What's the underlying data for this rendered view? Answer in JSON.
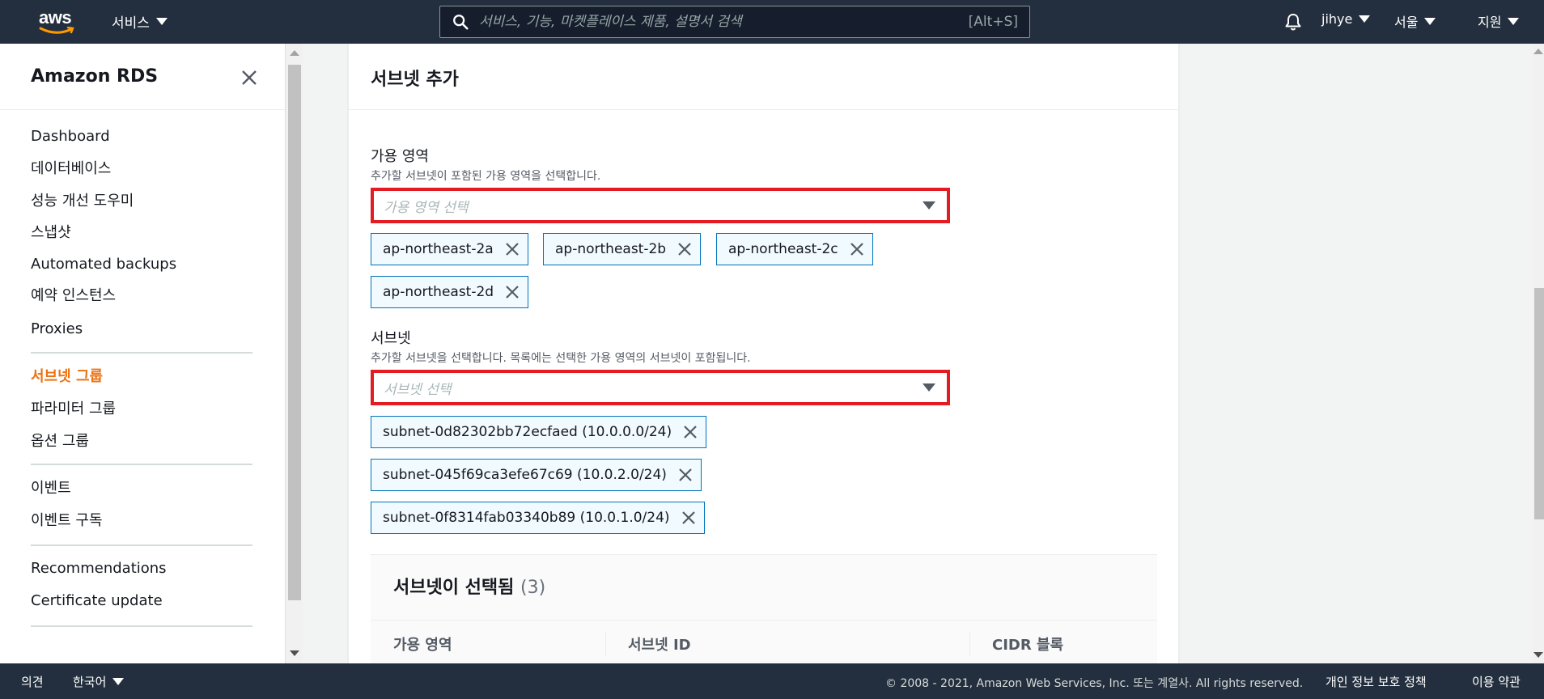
{
  "topnav": {
    "logo": "aws",
    "services_label": "서비스",
    "search_placeholder": "서비스, 기능, 마켓플레이스 제품, 설명서 검색",
    "search_shortcut": "[Alt+S]",
    "user_label": "jihye",
    "region_label": "서울",
    "support_label": "지원"
  },
  "sidebar": {
    "title": "Amazon RDS",
    "items": [
      "Dashboard",
      "데이터베이스",
      "성능 개선 도우미",
      "스냅샷",
      "Automated backups",
      "예약 인스턴스",
      "Proxies",
      "서브넷 그룹",
      "파라미터 그룹",
      "옵션 그룹",
      "이벤트",
      "이벤트 구독",
      "Recommendations",
      "Certificate update"
    ],
    "active_item": "서브넷 그룹"
  },
  "main": {
    "title": "서브넷 추가",
    "az_field": {
      "label": "가용 영역",
      "description": "추가할 서브넷이 포함된 가용 영역을 선택합니다.",
      "placeholder": "가용 영역 선택",
      "tokens": [
        "ap-northeast-2a",
        "ap-northeast-2b",
        "ap-northeast-2c",
        "ap-northeast-2d"
      ]
    },
    "subnet_field": {
      "label": "서브넷",
      "description": "추가할 서브넷을 선택합니다. 목록에는 선택한 가용 영역의 서브넷이 포함됩니다.",
      "placeholder": "서브넷 선택",
      "tokens": [
        "subnet-0d82302bb72ecfaed (10.0.0.0/24)",
        "subnet-045f69ca3efe67c69 (10.0.2.0/24)",
        "subnet-0f8314fab03340b89 (10.0.1.0/24)"
      ]
    },
    "selected": {
      "title": "서브넷이 선택됨",
      "count": "(3)",
      "columns": [
        "가용 영역",
        "서브넷 ID",
        "CIDR 블록"
      ]
    }
  },
  "footer": {
    "feedback": "의견",
    "language": "한국어",
    "copyright": "© 2008 - 2021, Amazon Web Services, Inc. 또는 계열사. All rights reserved.",
    "privacy": "개인 정보 보호 정책",
    "terms": "이용 약관"
  },
  "colors": {
    "nav_bg": "#232f3e",
    "accent_orange": "#ec7211",
    "highlight_red": "#e31b23",
    "token_border": "#0073bb"
  }
}
